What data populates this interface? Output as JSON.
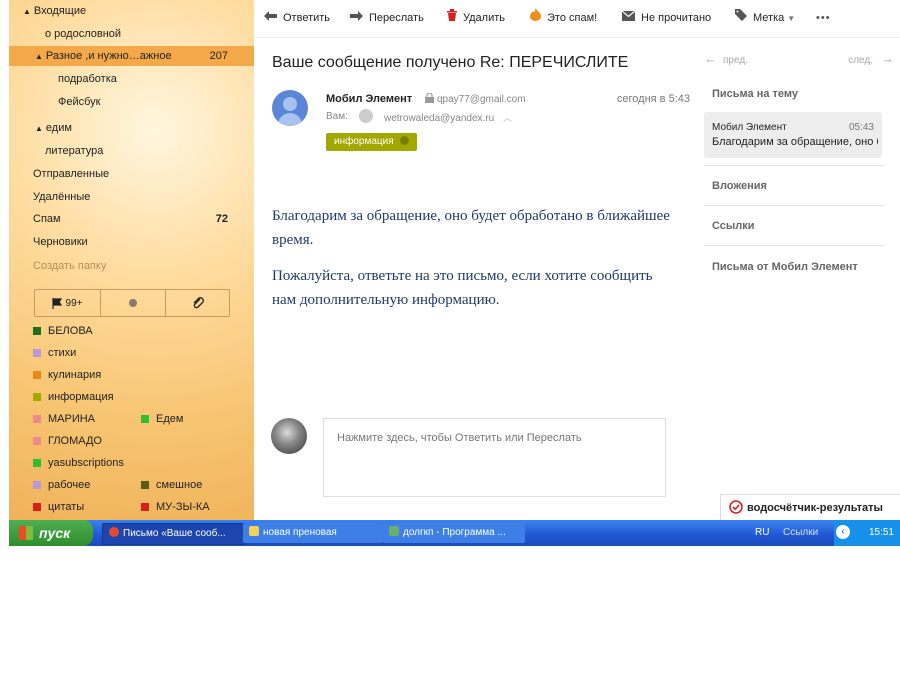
{
  "sidebar": {
    "folders": [
      {
        "label": "Входящие",
        "arrow": "▲",
        "count": ""
      },
      {
        "label": "о родословной",
        "arrow": "",
        "count": ""
      },
      {
        "label": "Разное ,и нужно…ажное",
        "arrow": "▲",
        "count": "207"
      },
      {
        "label": "подработка",
        "arrow": "",
        "count": ""
      },
      {
        "label": "Фейсбук",
        "arrow": "",
        "count": ""
      },
      {
        "label": "едим",
        "arrow": "▲",
        "count": ""
      },
      {
        "label": "литература",
        "arrow": "",
        "count": ""
      },
      {
        "label": "Отправленные",
        "arrow": "",
        "count": ""
      },
      {
        "label": "Удалённые",
        "arrow": "",
        "count": ""
      },
      {
        "label": "Спам",
        "arrow": "",
        "count": "72"
      },
      {
        "label": "Черновики",
        "arrow": "",
        "count": ""
      },
      {
        "label": "Создать папку",
        "arrow": "",
        "count": ""
      }
    ],
    "filters": {
      "flag_count": "99+"
    },
    "labels": [
      {
        "name": "БЕЛОВА",
        "color": "#1f6e1f"
      },
      {
        "name": "стихи",
        "color": "#b99ad6"
      },
      {
        "name": "кулинария",
        "color": "#e88a1a"
      },
      {
        "name": "информация",
        "color": "#a3a800"
      },
      {
        "name": "МАРИНА",
        "color": "#f08a8a"
      },
      {
        "name": "Едем",
        "color": "#2fbf2f"
      },
      {
        "name": "ГЛОМАДО",
        "color": "#f08a8a"
      },
      {
        "name": "yasubscriptions",
        "color": "#2fbf2f"
      },
      {
        "name": "рабочее",
        "color": "#b99ad6"
      },
      {
        "name": "смешное",
        "color": "#5a5a1a"
      },
      {
        "name": "цитаты",
        "color": "#d62020"
      },
      {
        "name": "МУ-ЗЫ-КА",
        "color": "#d62020"
      }
    ]
  },
  "toolbar": {
    "reply": "Ответить",
    "forward": "Переслать",
    "delete": "Удалить",
    "spam": "Это спам!",
    "unread": "Не прочитано",
    "tag": "Метка",
    "more": "•••"
  },
  "message": {
    "subject": "Ваше сообщение получено Re: ПЕРЕЧИСЛИТЕ",
    "sender": "Мобил Элемент",
    "sender_email": "qpay77@gmail.com",
    "time": "сегодня в 5:43",
    "to_label": "Вам:",
    "to_email": "wetrowaleda@yandex.ru",
    "tag": "информация",
    "body": [
      "Благодарим за обращение, оно будет обработано в ближайшее время.",
      "Пожалуйста, ответьте на это письмо, если хотите сообщить нам дополнительную информацию."
    ],
    "reply_placeholder": "Нажмите здесь, чтобы Ответить или Переслать"
  },
  "right_panel": {
    "prev": "пред.",
    "next": "след.",
    "thread_title": "Письма на тему",
    "thread_card": {
      "from": "Мобил Элемент",
      "time": "05:43",
      "snippet": "Благодарим за обращение, оно будет"
    },
    "attachments": "Вложения",
    "links": "Ссылки",
    "from_sender": "Письма от Мобил Элемент"
  },
  "notification": "водосчётчик-результаты",
  "taskbar": {
    "start": "пуск",
    "tasks": [
      "Письмо «Ваше сооб...",
      "новая преновая",
      "долгкп - Программа ..."
    ],
    "lang": "RU",
    "links": "Ссылки",
    "time": "15:51"
  }
}
